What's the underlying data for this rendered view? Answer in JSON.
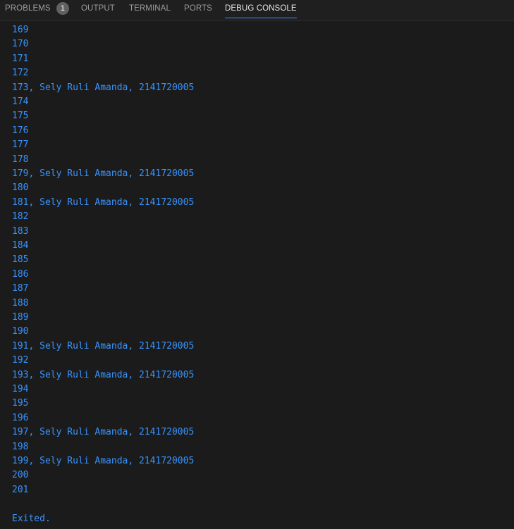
{
  "tabs": [
    {
      "label": "PROBLEMS",
      "badge": "1",
      "active": false
    },
    {
      "label": "OUTPUT",
      "active": false
    },
    {
      "label": "TERMINAL",
      "active": false
    },
    {
      "label": "PORTS",
      "active": false
    },
    {
      "label": "DEBUG CONSOLE",
      "active": true
    }
  ],
  "console": {
    "lines": [
      "169",
      "170",
      "171",
      "172",
      "173, Sely Ruli Amanda, 2141720005",
      "174",
      "175",
      "176",
      "177",
      "178",
      "179, Sely Ruli Amanda, 2141720005",
      "180",
      "181, Sely Ruli Amanda, 2141720005",
      "182",
      "183",
      "184",
      "185",
      "186",
      "187",
      "188",
      "189",
      "190",
      "191, Sely Ruli Amanda, 2141720005",
      "192",
      "193, Sely Ruli Amanda, 2141720005",
      "194",
      "195",
      "196",
      "197, Sely Ruli Amanda, 2141720005",
      "198",
      "199, Sely Ruli Amanda, 2141720005",
      "200",
      "201",
      "",
      "Exited."
    ],
    "text_color": "#3794ff"
  }
}
